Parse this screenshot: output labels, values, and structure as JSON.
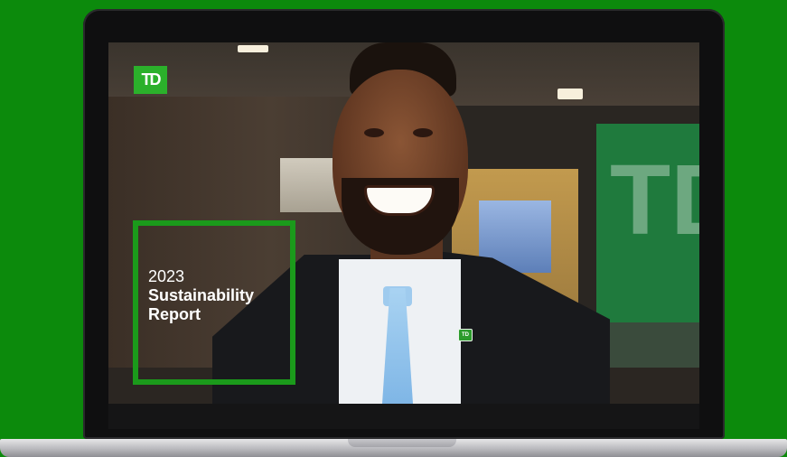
{
  "logo": {
    "text": "TD",
    "color": "#2bb02b"
  },
  "report": {
    "year": "2023",
    "line1": "Sustainability",
    "line2": "Report"
  },
  "lapel_pin": {
    "text": "TD"
  },
  "background_sign": {
    "text": "TD"
  },
  "colors": {
    "page_background": "#0c8a0c",
    "brand_green": "#2bb02b",
    "frame_green": "#1b9a1b"
  }
}
